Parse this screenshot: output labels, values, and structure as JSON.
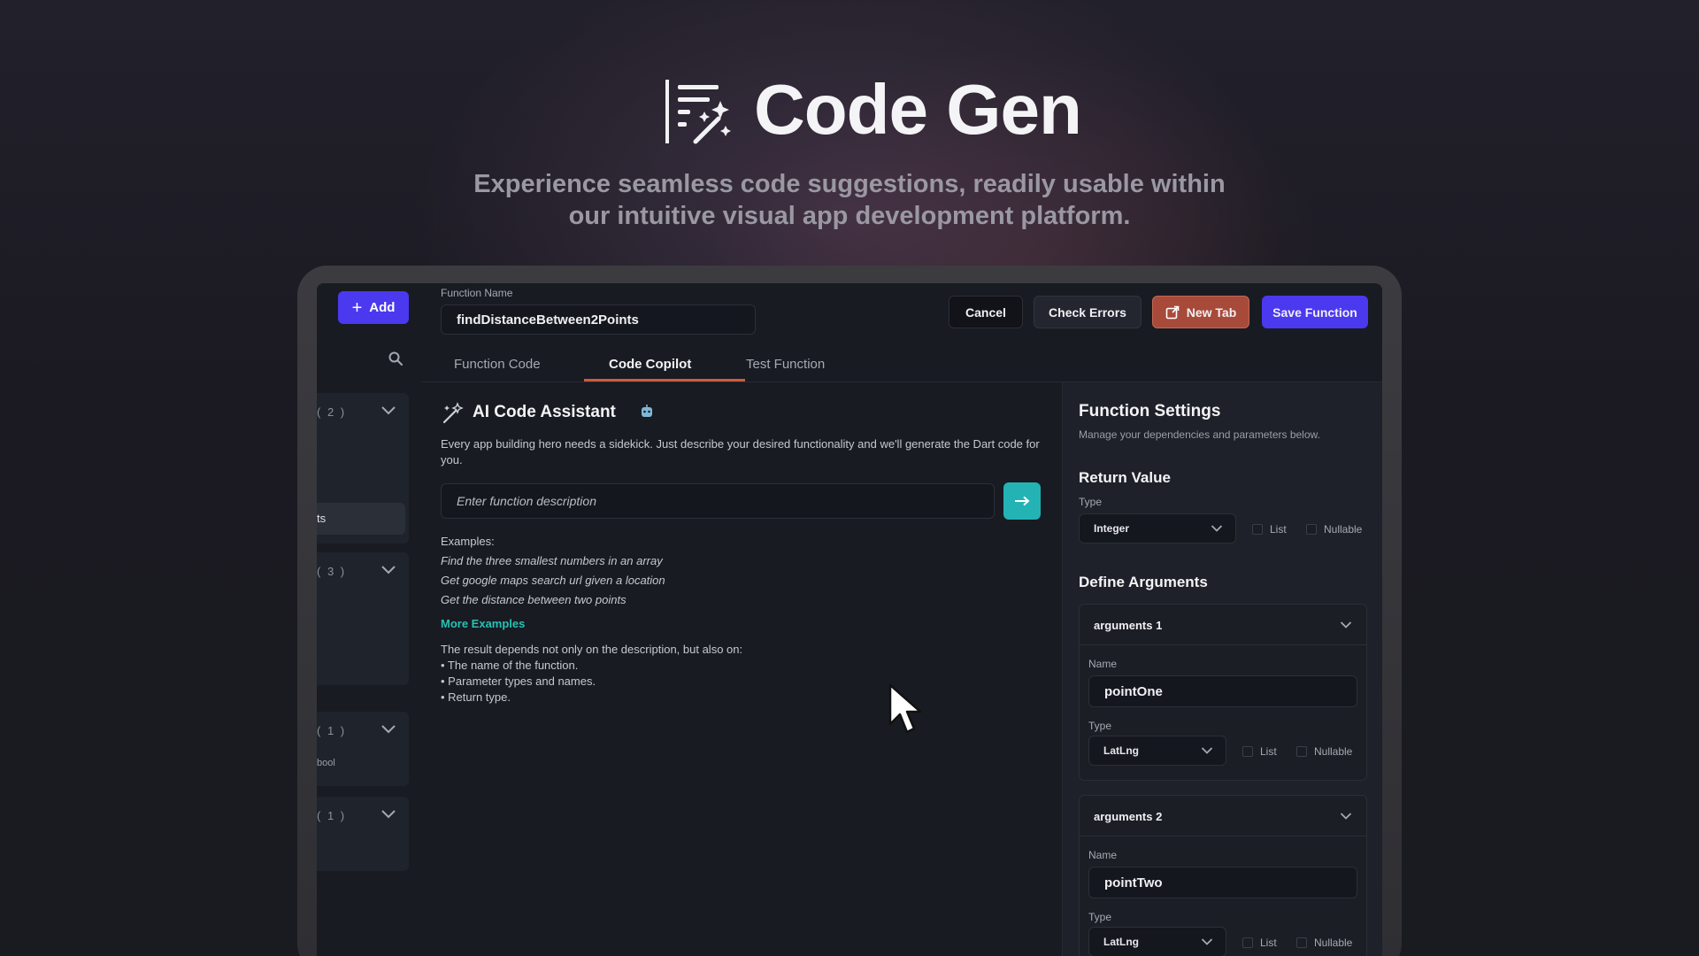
{
  "hero": {
    "title": "Code Gen",
    "subtitle_line1": "Experience seamless code suggestions, readily usable within",
    "subtitle_line2": "our intuitive visual app development platform."
  },
  "sidebar": {
    "add_label": "Add",
    "groups": [
      {
        "count": "( 2 )"
      },
      {
        "count": "( 3 )"
      },
      {
        "count": "( 1 )"
      },
      {
        "count": "( 1 )"
      }
    ],
    "selected_item": "ts",
    "sub_item": "bool"
  },
  "header": {
    "function_name_label": "Function Name",
    "function_name_value": "findDistanceBetween2Points",
    "cancel": "Cancel",
    "check_errors": "Check Errors",
    "new_tab": "New Tab",
    "save_function": "Save Function"
  },
  "tabs": [
    {
      "label": "Function Code"
    },
    {
      "label": "Code Copilot"
    },
    {
      "label": "Test Function"
    }
  ],
  "assistant": {
    "title": "AI Code Assistant",
    "description": "Every app building hero needs a sidekick. Just describe your desired functionality and we'll generate the Dart code for you.",
    "input_placeholder": "Enter function description",
    "examples_label": "Examples:",
    "examples": [
      "Find the three smallest numbers in an array",
      "Get google maps search url given a location",
      "Get the distance between two points"
    ],
    "more_examples": "More Examples",
    "note_intro": "The result depends not only on the description, but also on:",
    "note_items": [
      "• The name of the function.",
      "• Parameter types and names.",
      "• Return type."
    ]
  },
  "settings": {
    "title": "Function Settings",
    "subtitle": "Manage your dependencies and parameters below.",
    "return_value_title": "Return Value",
    "type_label": "Type",
    "return_type": "Integer",
    "list_label": "List",
    "nullable_label": "Nullable",
    "define_args_title": "Define Arguments",
    "arguments": [
      {
        "header": "arguments 1",
        "name_label": "Name",
        "name": "pointOne",
        "type_label": "Type",
        "type": "LatLng"
      },
      {
        "header": "arguments 2",
        "name_label": "Name",
        "name": "pointTwo",
        "type_label": "Type",
        "type": "LatLng"
      }
    ]
  },
  "colors": {
    "primary": "#4b39ef",
    "accent_teal": "#23b3b5",
    "new_tab": "#a84a3a",
    "tab_underline": "#d2593f",
    "link": "#26c1b4"
  }
}
